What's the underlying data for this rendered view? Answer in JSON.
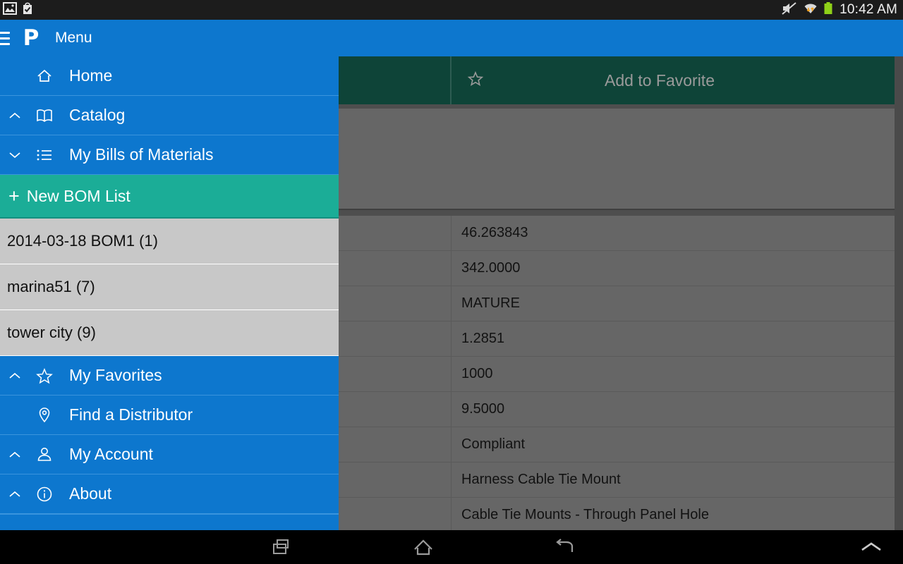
{
  "statusbar": {
    "notifications": [
      {
        "icon": "screenshot-icon"
      },
      {
        "icon": "app-installed-icon"
      }
    ],
    "mute_icon": "volume-muted-icon",
    "wifi_icon": "wifi-transfer-icon",
    "battery_icon": "battery-full-icon",
    "clock": "10:42 AM"
  },
  "appbar": {
    "menu_icon": "hamburger-menu-icon",
    "logo": "P",
    "title": "Menu",
    "background": "#0d77ce"
  },
  "drawer": {
    "background": "#0d77ce",
    "accent_green": "#1bad97",
    "items": [
      {
        "label": "Home",
        "icon": "home-icon",
        "chevron": ""
      },
      {
        "label": "Catalog",
        "icon": "book-icon",
        "chevron": "up"
      },
      {
        "label": "My Bills of Materials",
        "icon": "list-icon",
        "chevron": "down"
      }
    ],
    "new_bom": {
      "plus": "+",
      "label": "New BOM List"
    },
    "bom_lists": [
      {
        "label": "2014-03-18 BOM1 (1)"
      },
      {
        "label": "marina51 (7)"
      },
      {
        "label": "tower city (9)"
      }
    ],
    "items_lower": [
      {
        "label": "My Favorites",
        "icon": "star-icon",
        "chevron": "up"
      },
      {
        "label": "Find a Distributor",
        "icon": "map-pin-icon",
        "chevron": ""
      },
      {
        "label": "My Account",
        "icon": "person-icon",
        "chevron": "up"
      },
      {
        "label": "About",
        "icon": "info-circle-icon",
        "chevron": "up"
      }
    ]
  },
  "content": {
    "favorite_bar": {
      "star_icon": "star-outline-icon",
      "label": "Add to Favorite",
      "background": "#0e4438"
    },
    "table": {
      "rows": [
        {
          "label": "",
          "value": "46.263843"
        },
        {
          "label": "",
          "value": "342.0000"
        },
        {
          "label": "",
          "value": "MATURE"
        },
        {
          "label": "",
          "value": "1.2851"
        },
        {
          "label": "",
          "value": "1000"
        },
        {
          "label": "",
          "value": "9.5000"
        },
        {
          "label": "",
          "value": "Compliant"
        },
        {
          "label": "",
          "value": "Harness Cable Tie Mount"
        },
        {
          "label": "",
          "value": "Cable Tie Mounts - Through Panel Hole"
        }
      ]
    }
  },
  "navbar": {
    "recents_icon": "recents-icon",
    "home_icon": "home-nav-icon",
    "back_icon": "back-icon",
    "expand_icon": "chevron-up-icon"
  }
}
